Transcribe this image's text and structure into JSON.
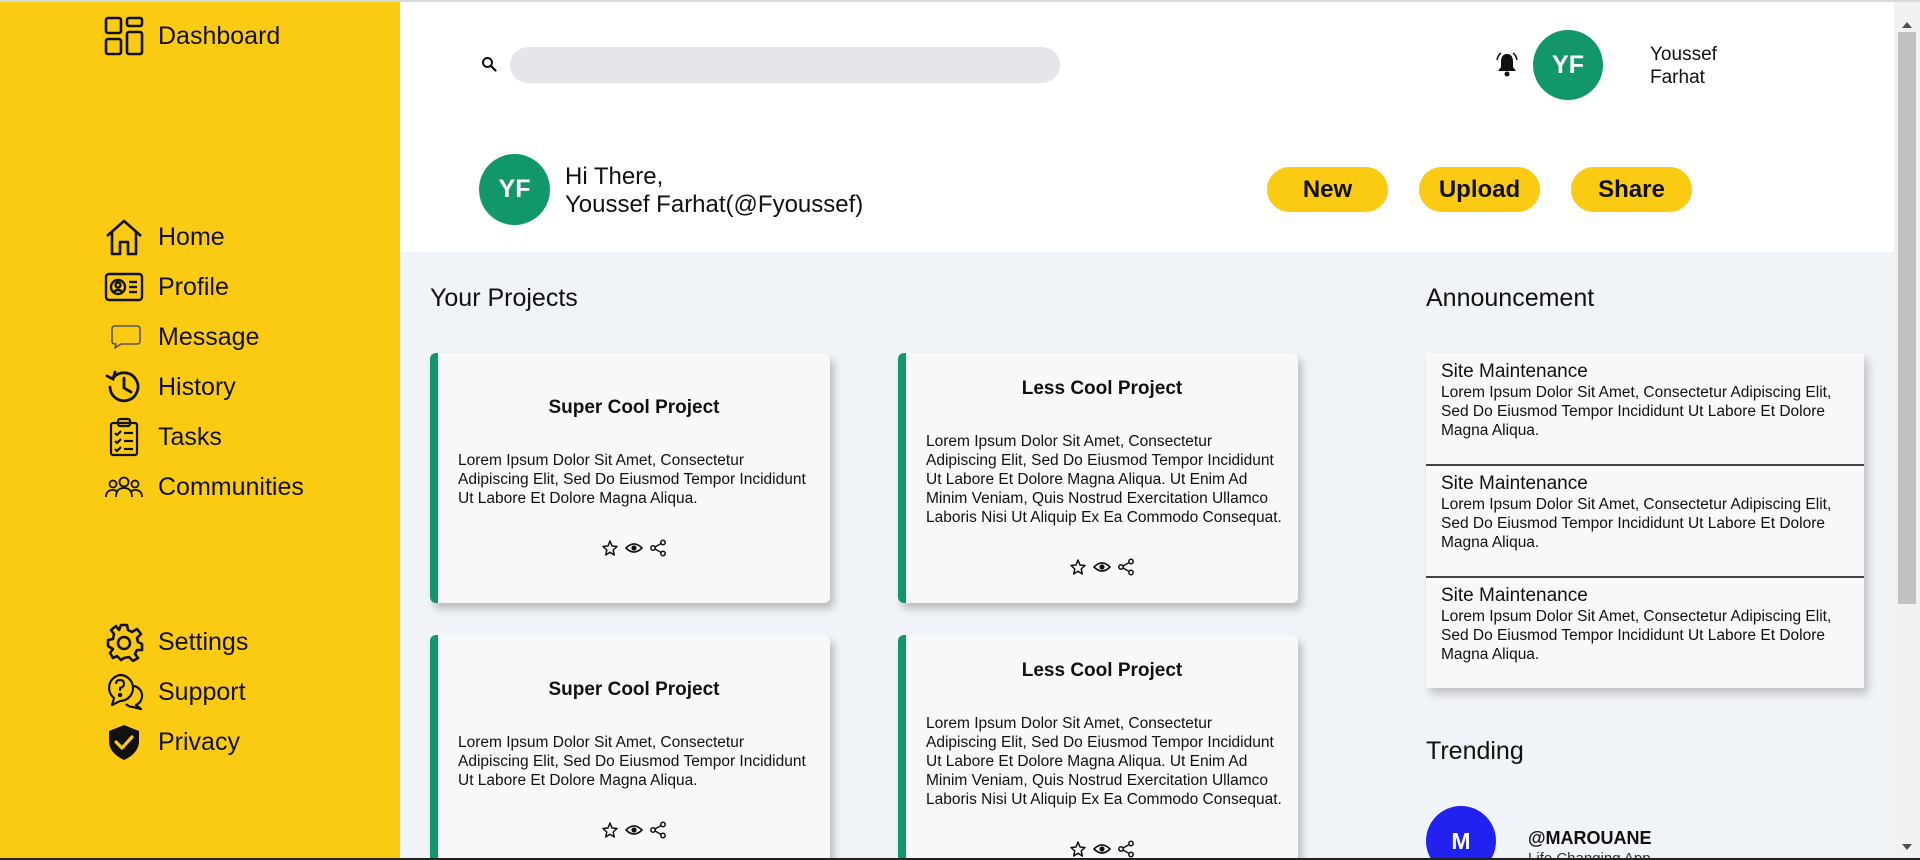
{
  "colors": {
    "sidebar": "#fbcb14",
    "accent_green": "#12976b",
    "main_bg": "#f0f3f7",
    "trend_avatar": "#2222f0"
  },
  "sidebar": {
    "dashboard": {
      "label": "Dashboard",
      "icon": "dashboard-icon"
    },
    "items": [
      {
        "label": "Home",
        "icon": "home-icon"
      },
      {
        "label": "Profile",
        "icon": "profile-card-icon"
      },
      {
        "label": "Message",
        "icon": "message-icon"
      },
      {
        "label": "History",
        "icon": "history-icon"
      },
      {
        "label": "Tasks",
        "icon": "tasks-icon"
      },
      {
        "label": "Communities",
        "icon": "communities-icon"
      }
    ],
    "bottom_items": [
      {
        "label": "Settings",
        "icon": "gear-icon"
      },
      {
        "label": "Support",
        "icon": "support-icon"
      },
      {
        "label": "Privacy",
        "icon": "shield-icon"
      }
    ]
  },
  "header": {
    "search": {
      "value": "",
      "placeholder": ""
    },
    "user": {
      "initials": "YF",
      "first_name": "Youssef",
      "last_name": "Farhat"
    },
    "greeting": {
      "line1": "Hi There,",
      "line2": "Youssef Farhat(@Fyoussef)",
      "initials": "YF"
    },
    "buttons": {
      "new": "New",
      "upload": "Upload",
      "share": "Share"
    }
  },
  "projects": {
    "title": "Your Projects",
    "cards": [
      {
        "title": "Super Cool Project",
        "text": "Lorem Ipsum Dolor Sit Amet, Consectetur Adipiscing Elit, Sed Do Eiusmod Tempor Incididunt Ut Labore Et Dolore Magna Aliqua."
      },
      {
        "title": "Less Cool Project",
        "text": "Lorem Ipsum Dolor Sit Amet, Consectetur Adipiscing Elit, Sed Do Eiusmod Tempor Incididunt Ut Labore Et Dolore Magna Aliqua. Ut Enim Ad Minim Veniam, Quis Nostrud Exercitation Ullamco Laboris Nisi Ut Aliquip Ex Ea Commodo Consequat."
      },
      {
        "title": "Super Cool Project",
        "text": "Lorem Ipsum Dolor Sit Amet, Consectetur Adipiscing Elit, Sed Do Eiusmod Tempor Incididunt Ut Labore Et Dolore Magna Aliqua."
      },
      {
        "title": "Less Cool Project",
        "text": "Lorem Ipsum Dolor Sit Amet, Consectetur Adipiscing Elit, Sed Do Eiusmod Tempor Incididunt Ut Labore Et Dolore Magna Aliqua. Ut Enim Ad Minim Veniam, Quis Nostrud Exercitation Ullamco Laboris Nisi Ut Aliquip Ex Ea Commodo Consequat."
      }
    ],
    "card_icons": [
      "star-icon",
      "eye-icon",
      "share-icon"
    ]
  },
  "announcement": {
    "title": "Announcement",
    "items": [
      {
        "title": "Site Maintenance",
        "text": "Lorem Ipsum Dolor Sit Amet, Consectetur Adipiscing Elit, Sed Do Eiusmod Tempor Incididunt Ut Labore Et Dolore Magna Aliqua."
      },
      {
        "title": "Site Maintenance",
        "text": "Lorem Ipsum Dolor Sit Amet, Consectetur Adipiscing Elit, Sed Do Eiusmod Tempor Incididunt Ut Labore Et Dolore Magna Aliqua."
      },
      {
        "title": "Site Maintenance",
        "text": "Lorem Ipsum Dolor Sit Amet, Consectetur Adipiscing Elit, Sed Do Eiusmod Tempor Incididunt Ut Labore Et Dolore Magna Aliqua."
      }
    ]
  },
  "trending": {
    "title": "Trending",
    "items": [
      {
        "initial": "M",
        "handle": "@MAROUANE",
        "subtitle": "Life Changing App"
      }
    ]
  }
}
